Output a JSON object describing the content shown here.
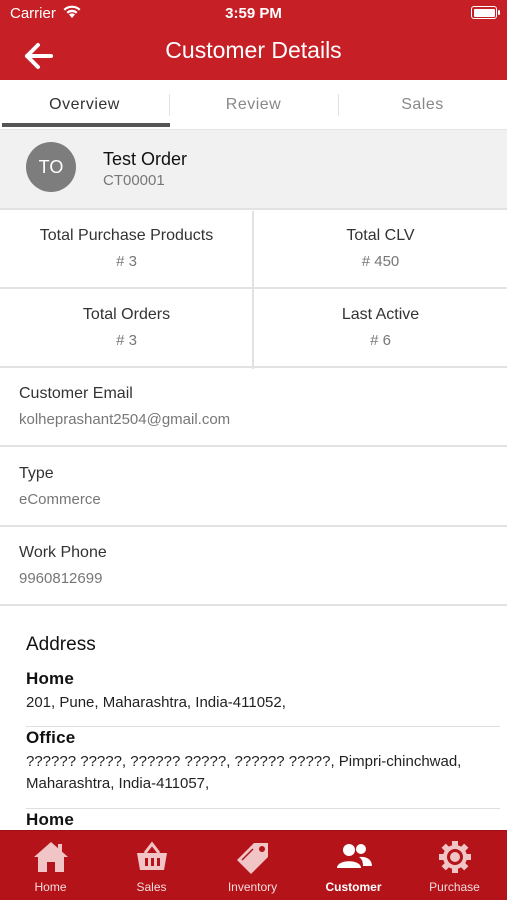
{
  "status": {
    "carrier": "Carrier",
    "time": "3:59 PM"
  },
  "nav": {
    "title": "Customer Details",
    "back_icon": "back-arrow-icon"
  },
  "tabs": [
    {
      "label": "Overview",
      "active": true
    },
    {
      "label": "Review",
      "active": false
    },
    {
      "label": "Sales",
      "active": false
    }
  ],
  "customer": {
    "initials": "TO",
    "name": "Test Order",
    "code": "CT00001"
  },
  "stats": [
    {
      "label": "Total Purchase Products",
      "value": "# 3"
    },
    {
      "label": "Total CLV",
      "value": "# 450"
    },
    {
      "label": "Total Orders",
      "value": "# 3"
    },
    {
      "label": "Last Active",
      "value": "# 6"
    }
  ],
  "info": [
    {
      "label": "Customer Email",
      "value": "kolheprashant2504@gmail.com"
    },
    {
      "label": "Type",
      "value": "eCommerce"
    },
    {
      "label": "Work Phone",
      "value": "9960812699"
    }
  ],
  "address": {
    "title": "Address",
    "entries": [
      {
        "type": "Home",
        "text": "201, Pune, Maharashtra, India-411052,"
      },
      {
        "type": "Office",
        "text": "?????? ?????, ?????? ?????, ?????? ?????, Pimpri-chinchwad, Maharashtra, India-411057,"
      },
      {
        "type": "Home",
        "text": ""
      }
    ]
  },
  "tabbar": [
    {
      "label": "Home",
      "icon": "home-icon",
      "active": false
    },
    {
      "label": "Sales",
      "icon": "shopping-basket-icon",
      "active": false
    },
    {
      "label": "Inventory",
      "icon": "price-tag-icon",
      "active": false
    },
    {
      "label": "Customer",
      "icon": "users-icon",
      "active": true
    },
    {
      "label": "Purchase",
      "icon": "gear-icon",
      "active": false
    }
  ],
  "colors": {
    "brand_red": "#c62026",
    "tabbar_red": "#b41419"
  }
}
